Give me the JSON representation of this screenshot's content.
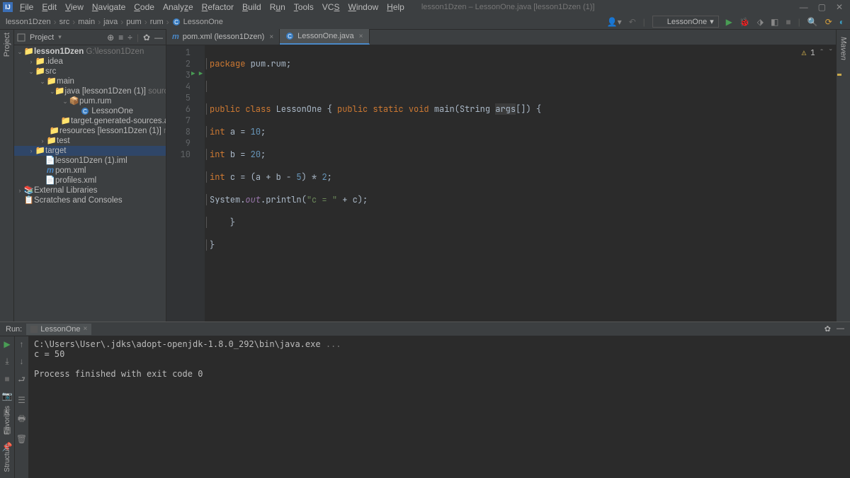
{
  "title": "lesson1Dzen – LessonOne.java [lesson1Dzen (1)]",
  "menu": [
    "File",
    "Edit",
    "View",
    "Navigate",
    "Code",
    "Analyze",
    "Refactor",
    "Build",
    "Run",
    "Tools",
    "VCS",
    "Window",
    "Help"
  ],
  "breadcrumbs": [
    "lesson1Dzen",
    "src",
    "main",
    "java",
    "pum",
    "rum",
    "LessonOne"
  ],
  "run_config": "LessonOne",
  "project_panel_label": "Project",
  "tree": {
    "root": "lesson1Dzen",
    "root_path": "G:\\lesson1Dzen",
    "idea": ".idea",
    "src": "src",
    "main": "main",
    "java": "java [lesson1Dzen (1)]",
    "java_hint": "sources root",
    "pkg": "pum.rum",
    "cls": "LessonOne",
    "target_gen": "target.generated-sources.annotations",
    "resources": "resources [lesson1Dzen (1)]",
    "resources_hint": "resources r",
    "test": "test",
    "target": "target",
    "iml": "lesson1Dzen (1).iml",
    "pom": "pom.xml",
    "profiles": "profiles.xml",
    "ext": "External Libraries",
    "scratch": "Scratches and Consoles"
  },
  "tabs": [
    {
      "label": "pom.xml (lesson1Dzen)",
      "active": false,
      "icon": "m"
    },
    {
      "label": "LessonOne.java",
      "active": true,
      "icon": "C"
    }
  ],
  "gutter_lines": [
    "1",
    "2",
    "3",
    "4",
    "5",
    "6",
    "7",
    "8",
    "9",
    "10"
  ],
  "code": {
    "l1_pre": "package ",
    "l1_pkg": "pum.rum",
    "l1_post": ";",
    "l3a": "public class ",
    "l3b": "LessonOne",
    "l3c": " { ",
    "l3d": "public static void ",
    "l3e": "main",
    "l3f": "(String ",
    "l3g": "args",
    "l3h": "[]) {",
    "l4a": "int ",
    "l4b": "a = ",
    "l4n": "10",
    "l4c": ";",
    "l5a": "int ",
    "l5b": "b = ",
    "l5n": "20",
    "l5c": ";",
    "l6a": "int ",
    "l6b": "c = (a + b - ",
    "l6n1": "5",
    "l6c": ") * ",
    "l6n2": "2",
    "l6d": ";",
    "l7a": "System.",
    "l7b": "out",
    "l7c": ".println(",
    "l7s": "\"c = \"",
    "l7d": " + c);",
    "l8": "    }",
    "l9": "}"
  },
  "warnings": "1",
  "run_tab_label": "Run:",
  "run_tab_name": "LessonOne",
  "console": {
    "line1": "C:\\Users\\User\\.jdks\\adopt-openjdk-1.8.0_292\\bin\\java.exe ",
    "line1_dim": "...",
    "line2": "c = 50",
    "line3": "",
    "line4": "Process finished with exit code 0"
  },
  "side_left": [
    "Project"
  ],
  "side_left_bottom": [
    "Structure",
    "Favorites"
  ],
  "side_right": "Maven"
}
